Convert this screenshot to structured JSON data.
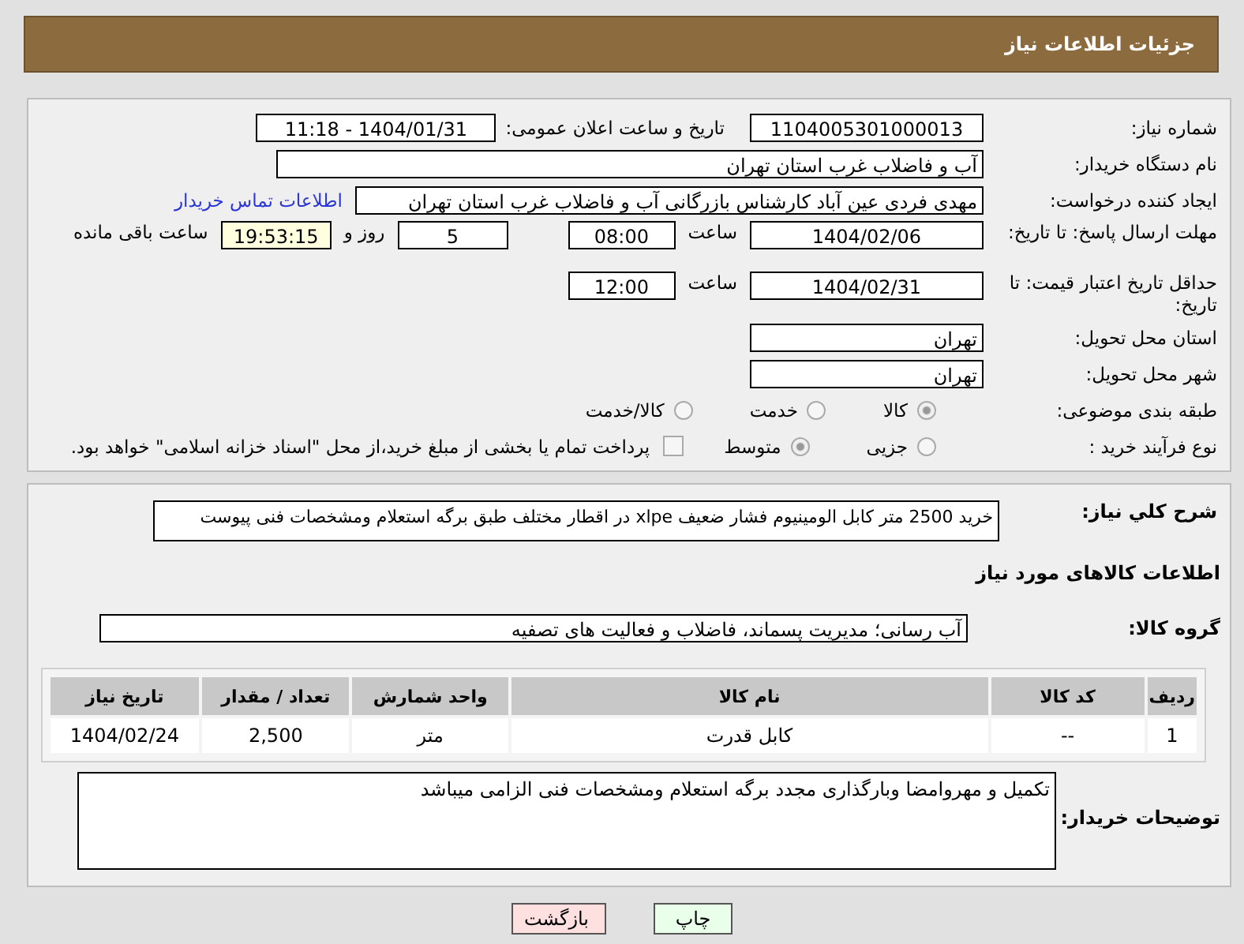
{
  "header": {
    "title": "جزئیات اطلاعات نیاز"
  },
  "need_number": {
    "label": "شماره نیاز:",
    "value": "1104005301000013"
  },
  "announce": {
    "label": "تاریخ و ساعت اعلان عمومی:",
    "value": "1404/01/31 - 11:18"
  },
  "buyer_org": {
    "label": "نام دستگاه خریدار:",
    "value": "آب و فاضلاب غرب استان تهران"
  },
  "requester": {
    "label": "ایجاد کننده درخواست:",
    "value": "مهدی فردی عین آباد کارشناس بازرگانی آب و فاضلاب غرب استان تهران",
    "contact_link": "اطلاعات تماس خریدار"
  },
  "deadline": {
    "label": "مهلت ارسال پاسخ: تا تاریخ:",
    "date": "1404/02/06",
    "time_label": "ساعت",
    "time": "08:00",
    "days": "5",
    "days_label": "روز و",
    "remaining": "19:53:15",
    "remaining_label": "ساعت باقی مانده"
  },
  "validity": {
    "label": "حداقل تاریخ اعتبار قیمت: تا تاریخ:",
    "date": "1404/02/31",
    "time_label": "ساعت",
    "time": "12:00"
  },
  "province": {
    "label": "استان محل تحویل:",
    "value": "تهران"
  },
  "city": {
    "label": "شهر محل تحویل:",
    "value": "تهران"
  },
  "category": {
    "label": "طبقه بندی موضوعی:",
    "options": [
      {
        "label": "کالا",
        "selected": true
      },
      {
        "label": "خدمت",
        "selected": false
      },
      {
        "label": "کالا/خدمت",
        "selected": false
      }
    ]
  },
  "process": {
    "label": "نوع فرآیند خرید :",
    "options": [
      {
        "label": "جزیی",
        "selected": false
      },
      {
        "label": "متوسط",
        "selected": true
      }
    ],
    "payment": {
      "label": "پرداخت تمام یا بخشی از مبلغ خرید،از محل \"اسناد خزانه اسلامی\" خواهد بود.",
      "checked": false
    }
  },
  "description": {
    "label": "شرح کلي نياز:",
    "value": "خرید 2500 متر کابل الومینیوم فشار ضعیف xlpe در اقطار مختلف طبق برگه استعلام ومشخصات فنی پیوست"
  },
  "goods_title": "اطلاعات کالاهای مورد نیاز",
  "goods_group": {
    "label": "گروه کالا:",
    "value": "آب رسانی؛ مدیریت پسماند، فاضلاب و فعالیت های تصفیه"
  },
  "table": {
    "columns": [
      "ردیف",
      "کد کالا",
      "نام کالا",
      "واحد شمارش",
      "تعداد / مقدار",
      "تاریخ نیاز"
    ],
    "rows": [
      [
        "1",
        "--",
        "کابل قدرت",
        "متر",
        "2,500",
        "1404/02/24"
      ]
    ]
  },
  "buyer_notes": {
    "label": "توضیحات خریدار:",
    "value": "تکمیل و مهروامضا وبارگذاری مجدد برگه استعلام ومشخصات فنی الزامی میباشد"
  },
  "buttons": [
    {
      "label": "چاپ",
      "kind": "print"
    },
    {
      "label": "بازگشت",
      "kind": "back"
    }
  ]
}
